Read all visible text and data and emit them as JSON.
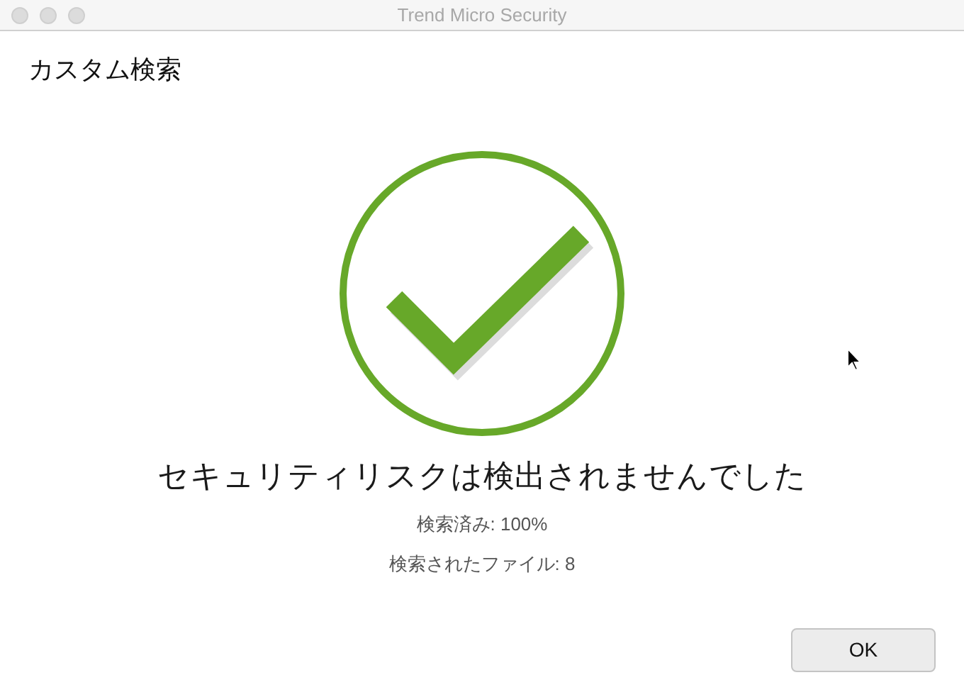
{
  "window": {
    "title": "Trend Micro Security"
  },
  "heading": "カスタム検索",
  "result": {
    "message": "セキュリティリスクは検出されませんでした",
    "details": [
      "検索済み: 100%",
      "検索されたファイル: 8"
    ]
  },
  "buttons": [
    "OK"
  ]
}
